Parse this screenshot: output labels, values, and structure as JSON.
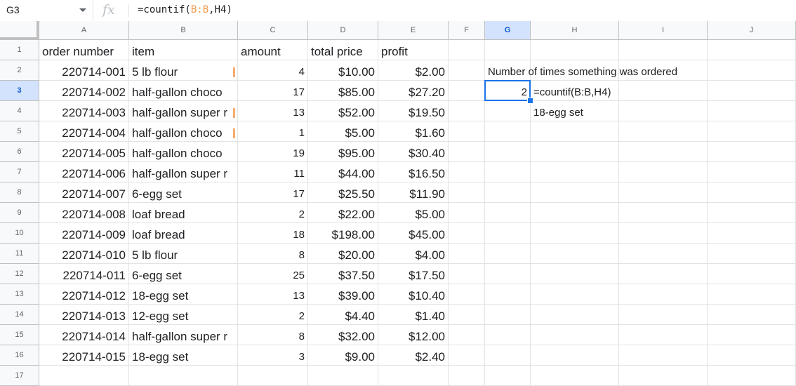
{
  "formula_bar": {
    "cell_ref": "G3",
    "fx_label": "fx",
    "formula_prefix": "=countif(",
    "formula_ref": "B:B",
    "formula_sep": ",",
    "formula_ref2": "H4",
    "formula_suffix": ")"
  },
  "columns": [
    "A",
    "B",
    "C",
    "D",
    "E",
    "F",
    "G",
    "H",
    "I",
    "J"
  ],
  "rows": [
    "1",
    "2",
    "3",
    "4",
    "5",
    "6",
    "7",
    "8",
    "9",
    "10",
    "11",
    "12",
    "13",
    "14",
    "15",
    "16",
    "17"
  ],
  "headers": {
    "order_number": "order number",
    "item": "item",
    "amount": "amount",
    "total_price": "total price",
    "profit": "profit"
  },
  "table": [
    {
      "order": "220714-001",
      "item": "5 lb flour",
      "amount": "4",
      "total": "$10.00",
      "profit": "$2.00"
    },
    {
      "order": "220714-002",
      "item": "half-gallon choco",
      "amount": "17",
      "total": "$85.00",
      "profit": "$27.20"
    },
    {
      "order": "220714-003",
      "item": "half-gallon super r",
      "amount": "13",
      "total": "$52.00",
      "profit": "$19.50"
    },
    {
      "order": "220714-004",
      "item": "half-gallon choco",
      "amount": "1",
      "total": "$5.00",
      "profit": "$1.60"
    },
    {
      "order": "220714-005",
      "item": "half-gallon choco",
      "amount": "19",
      "total": "$95.00",
      "profit": "$30.40"
    },
    {
      "order": "220714-006",
      "item": "half-gallon super r",
      "amount": "11",
      "total": "$44.00",
      "profit": "$16.50"
    },
    {
      "order": "220714-007",
      "item": "6-egg set",
      "amount": "17",
      "total": "$25.50",
      "profit": "$11.90"
    },
    {
      "order": "220714-008",
      "item": "loaf bread",
      "amount": "2",
      "total": "$22.00",
      "profit": "$5.00"
    },
    {
      "order": "220714-009",
      "item": "loaf bread",
      "amount": "18",
      "total": "$198.00",
      "profit": "$45.00"
    },
    {
      "order": "220714-010",
      "item": "5 lb flour",
      "amount": "8",
      "total": "$20.00",
      "profit": "$4.00"
    },
    {
      "order": "220714-011",
      "item": "6-egg set",
      "amount": "25",
      "total": "$37.50",
      "profit": "$17.50"
    },
    {
      "order": "220714-012",
      "item": "18-egg set",
      "amount": "13",
      "total": "$39.00",
      "profit": "$10.40"
    },
    {
      "order": "220714-013",
      "item": "12-egg set",
      "amount": "2",
      "total": "$4.40",
      "profit": "$1.40"
    },
    {
      "order": "220714-014",
      "item": "half-gallon super r",
      "amount": "8",
      "total": "$32.00",
      "profit": "$12.00"
    },
    {
      "order": "220714-015",
      "item": "18-egg set",
      "amount": "3",
      "total": "$9.00",
      "profit": "$2.40"
    }
  ],
  "side": {
    "g2_label": "Number of times something was ordered",
    "g3_value": "2",
    "h3_text": "=countif(B:B,H4)",
    "h4_text": "18-egg set"
  },
  "colors": {
    "selection": "#1a73e8",
    "header_bg": "#f8f9fa",
    "selected_header_bg": "#d3e3fd",
    "range_ref": "#f29a50"
  }
}
